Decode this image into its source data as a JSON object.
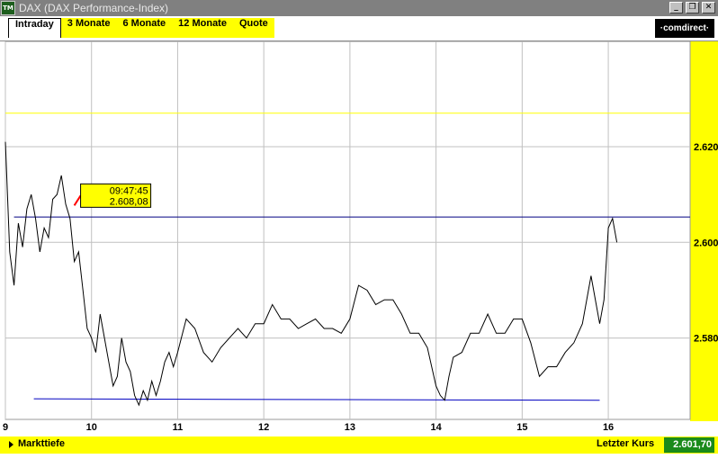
{
  "window": {
    "icon_text": "TM",
    "title": "DAX (DAX Performance-Index)",
    "buttons": [
      "_",
      "❐",
      "✕"
    ]
  },
  "tabs": [
    {
      "label": "Intraday",
      "active": true
    },
    {
      "label": "3 Monate",
      "active": false
    },
    {
      "label": "6 Monate",
      "active": false
    },
    {
      "label": "12 Monate",
      "active": false
    },
    {
      "label": "Quote",
      "active": false
    }
  ],
  "brand": "·comdirect·",
  "tooltip": {
    "time": "09:47:45",
    "value": "2.608,08"
  },
  "statusbar": {
    "depth_label": "Markttiefe",
    "last_label": "Letzter Kurs",
    "last_value": "2.601,70"
  },
  "colors": {
    "accent": "#ffff00",
    "price": "#00ff00",
    "line": "#000080"
  },
  "chart_data": {
    "type": "line",
    "series": [
      {
        "x": [
          9.0,
          9.05,
          9.1,
          9.15,
          9.2,
          9.25,
          9.3,
          9.35,
          9.4,
          9.45,
          9.5,
          9.55,
          9.6,
          9.65,
          9.7,
          9.75,
          9.8,
          9.85,
          9.9,
          9.95,
          10.0,
          10.05,
          10.1,
          10.15,
          10.2,
          10.25,
          10.3,
          10.35,
          10.4,
          10.45,
          10.5,
          10.55,
          10.6,
          10.65,
          10.7,
          10.75,
          10.8,
          10.85,
          10.9,
          10.95,
          11.0,
          11.1,
          11.2,
          11.3,
          11.4,
          11.5,
          11.6,
          11.7,
          11.8,
          11.9,
          12.0,
          12.1,
          12.2,
          12.3,
          12.4,
          12.5,
          12.6,
          12.7,
          12.8,
          12.9,
          13.0,
          13.1,
          13.2,
          13.3,
          13.4,
          13.5,
          13.6,
          13.7,
          13.8,
          13.9,
          14.0,
          14.05,
          14.1,
          14.15,
          14.2,
          14.3,
          14.4,
          14.5,
          14.6,
          14.7,
          14.8,
          14.9,
          15.0,
          15.1,
          15.2,
          15.3,
          15.4,
          15.5,
          15.6,
          15.7,
          15.8,
          15.85,
          15.9,
          15.95,
          16.0,
          16.05,
          16.1
        ],
        "y": [
          2621.0,
          2598.0,
          2591.0,
          2604.0,
          2599.0,
          2607.0,
          2610.0,
          2605.0,
          2598.0,
          2603.0,
          2601.0,
          2609.0,
          2610.0,
          2614.0,
          2608.0,
          2605.0,
          2596.0,
          2598.0,
          2590.0,
          2582.0,
          2580.0,
          2577.0,
          2585.0,
          2580.0,
          2575.0,
          2570.0,
          2572.0,
          2580.0,
          2575.0,
          2573.0,
          2568.0,
          2566.0,
          2569.0,
          2567.0,
          2571.0,
          2568.0,
          2571.0,
          2575.0,
          2577.0,
          2574.0,
          2577.0,
          2584.0,
          2582.0,
          2577.0,
          2575.0,
          2578.0,
          2580.0,
          2582.0,
          2580.0,
          2583.0,
          2583.0,
          2587.0,
          2584.0,
          2584.0,
          2582.0,
          2583.0,
          2584.0,
          2582.0,
          2582.0,
          2581.0,
          2584.0,
          2591.0,
          2590.0,
          2587.0,
          2588.0,
          2588.0,
          2585.0,
          2581.0,
          2581.0,
          2578.0,
          2570.0,
          2568.0,
          2567.0,
          2572.0,
          2576.0,
          2577.0,
          2581.0,
          2581.0,
          2585.0,
          2581.0,
          2581.0,
          2584.0,
          2584.0,
          2579.0,
          2572.0,
          2574.0,
          2574.0,
          2577.0,
          2579.0,
          2583.0,
          2593.0,
          2588.0,
          2583.0,
          2588.0,
          2603.0,
          2605.0,
          2600.0
        ],
        "color": "#000000"
      }
    ],
    "xlim": [
      9.0,
      16.95
    ],
    "ylim": [
      2563.0,
      2642.0
    ],
    "xticks": [
      9,
      10,
      11,
      12,
      13,
      14,
      15,
      16
    ],
    "yticks": [
      2580,
      2600,
      2620
    ],
    "ytick_labels": [
      "2.580",
      "2.600",
      "2.620"
    ],
    "reference_lines": [
      {
        "kind": "horizontal",
        "y": 2627,
        "color": "#ffff00"
      },
      {
        "kind": "horizontal",
        "y": 2605.3,
        "x_from": 9.1,
        "x_to": 16.95,
        "color": "#000080"
      },
      {
        "kind": "segment",
        "x1": 9.33,
        "y1": 2567.3,
        "x2": 15.9,
        "y2": 2567.0,
        "color": "#0000c0"
      }
    ],
    "grid": true
  }
}
